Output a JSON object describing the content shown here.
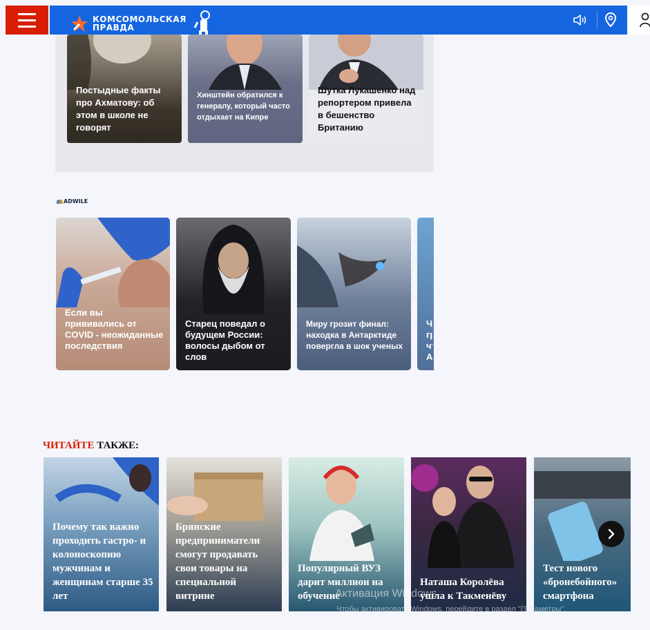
{
  "header": {
    "logo_line1": "КОМСОМОЛЬСКАЯ",
    "logo_line2": "ПРАВДА",
    "brand_color": "#1565e0",
    "accent_color": "#d81e05",
    "icons": [
      "menu-icon",
      "speaker-icon",
      "location-pin-icon",
      "user-icon"
    ]
  },
  "top_cards": [
    {
      "title": "Постыдные факты про Ахматову: об этом в школе не говорят"
    },
    {
      "title": "Хинштейн обратился к генералу, который часто отдыхает на Кипре"
    },
    {
      "title": "Шутка Лукашенко над репортером привела в бешенство Британию"
    }
  ],
  "adwile": {
    "label": "ADWILE",
    "cards": [
      {
        "title": "Если вы прививались от COVID - неожиданные последствия"
      },
      {
        "title": "Старец поведал о будущем России: волосы дыбом от слов"
      },
      {
        "title": "Миру грозит финал: находка в Антарктиде повергла в шок ученых"
      },
      {
        "title": "Ч гр чт А"
      }
    ]
  },
  "read_also": {
    "title_red": "ЧИТАЙТЕ",
    "title_black": " ТАКЖЕ:",
    "cards": [
      {
        "title": "Почему так важно проходить гастро- и колоноскопию мужчинам и женщинам старше 35 лет"
      },
      {
        "title": "Брянские предприниматели смогут продавать свои товары на специальной витрине"
      },
      {
        "title": "Популярный ВУЗ дарит миллион на обучение"
      },
      {
        "title": "Наташа Королёва ушла к Такменёву"
      },
      {
        "title": "Тест нового «бронебойного» смартфона"
      }
    ],
    "next_icon": "chevron-right-icon"
  },
  "watermark": {
    "line1": "Активация Windows",
    "line2": "Чтобы активировать Windows, перейдите в раздел \"Параметры\"."
  }
}
